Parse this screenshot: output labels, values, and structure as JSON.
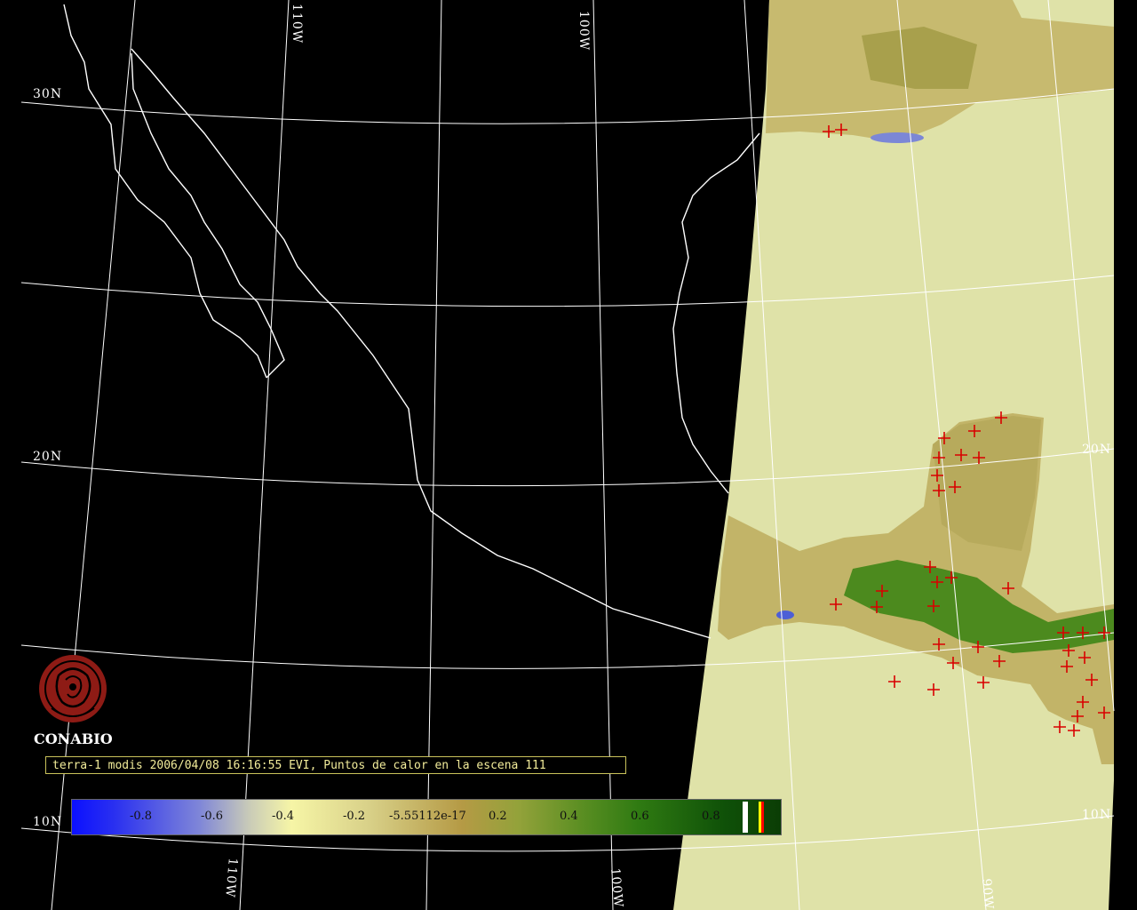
{
  "map": {
    "grid_labels": {
      "lat_30n": "30N",
      "lat_20n_left": "20N",
      "lat_20n_right": "20N",
      "lat_10n_left": "10N",
      "lat_10n_right": "10N",
      "lon_110w_top": "110W",
      "lon_100w_top": "100W",
      "lon_110w_bottom": "110W",
      "lon_100w_bottom": "100W",
      "lon_90w_bottom": "90W"
    },
    "scene_land_color": "#dfe2a8",
    "fire_marker_color": "#d90000",
    "coastline_color": "#ffffff"
  },
  "logo": {
    "name": "CONABIO",
    "color": "#8e1b15"
  },
  "caption": {
    "text": "terra-1 modis 2006/04/08 16:16:55 EVI, Puntos de calor en la escena 111"
  },
  "colorbar": {
    "ticks": [
      "-0.8",
      "-0.6",
      "-0.4",
      "-0.2",
      "-5.55112e-17",
      "0.2",
      "0.4",
      "0.6",
      "0.8"
    ],
    "extra_swatches": [
      "#ffffff",
      "#ffff00",
      "#ff0000"
    ]
  }
}
